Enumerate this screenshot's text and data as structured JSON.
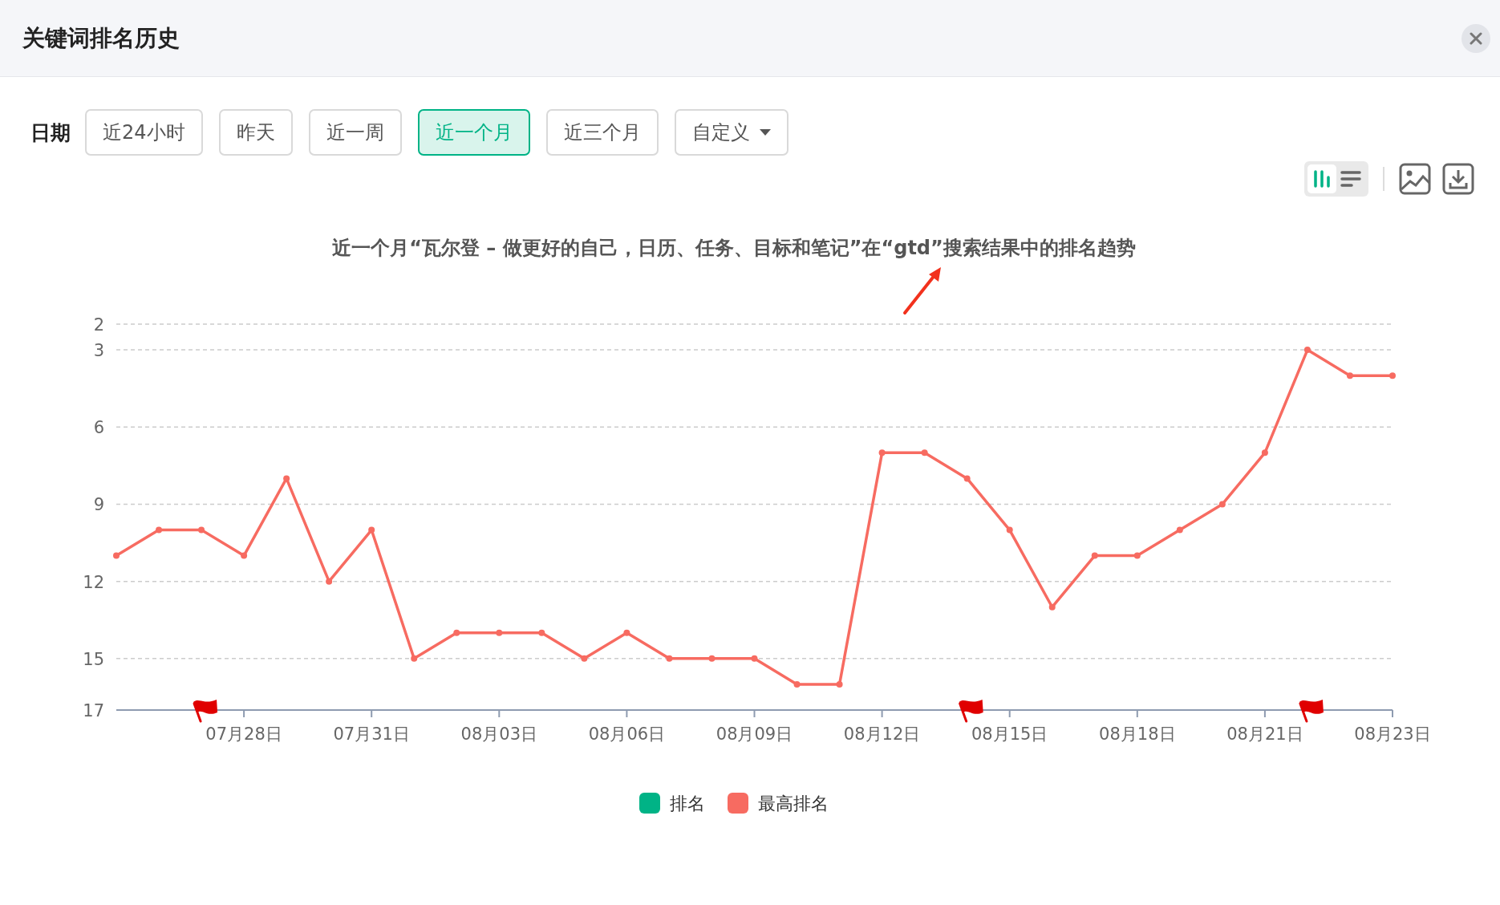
{
  "window": {
    "title": "关键词排名历史"
  },
  "date_filter": {
    "label": "日期",
    "options": [
      {
        "label": "近24小时",
        "selected": false,
        "kind": "button"
      },
      {
        "label": "昨天",
        "selected": false,
        "kind": "button"
      },
      {
        "label": "近一周",
        "selected": false,
        "kind": "button"
      },
      {
        "label": "近一个月",
        "selected": true,
        "kind": "button"
      },
      {
        "label": "近三个月",
        "selected": false,
        "kind": "button"
      },
      {
        "label": "自定义",
        "selected": false,
        "kind": "dropdown"
      }
    ]
  },
  "view_toggle": [
    {
      "kind": "bars",
      "selected": true
    },
    {
      "kind": "list",
      "selected": false
    }
  ],
  "chart": {
    "chart_data": {
      "type": "line",
      "title": "近一个月“瓦尔登 – 做更好的自己，日历、任务、目标和笔记”在“gtd”搜索结果中的排名趋势",
      "categories": [
        null,
        null,
        null,
        "07月28日",
        null,
        null,
        "07月31日",
        null,
        null,
        "08月03日",
        null,
        null,
        "08月06日",
        null,
        null,
        "08月09日",
        null,
        null,
        "08月12日",
        null,
        null,
        "08月15日",
        null,
        null,
        "08月18日",
        null,
        null,
        "08月21日",
        null,
        null,
        "08月23日"
      ],
      "series": [
        {
          "name": "排名",
          "color": "#00b386",
          "values": [
            null,
            null,
            null,
            null,
            null,
            null,
            null,
            null,
            null,
            null,
            null,
            null,
            null,
            null,
            null,
            null,
            null,
            null,
            null,
            null,
            null,
            null,
            null,
            null,
            null,
            null,
            null,
            null,
            null,
            null,
            null
          ]
        },
        {
          "name": "最高排名",
          "color": "#f76b61",
          "marker": "circle",
          "values": [
            11,
            10,
            10,
            11,
            8,
            12,
            10,
            15,
            14,
            14,
            14,
            15,
            14,
            15,
            15,
            15,
            16,
            16,
            7,
            7,
            8,
            10,
            13,
            11,
            11,
            10,
            9,
            7,
            3,
            4,
            4
          ]
        }
      ],
      "ylim": [
        17,
        2
      ],
      "yticks": [
        2,
        3,
        6,
        9,
        12,
        15,
        17
      ],
      "grid": true,
      "legend": true
    }
  }
}
